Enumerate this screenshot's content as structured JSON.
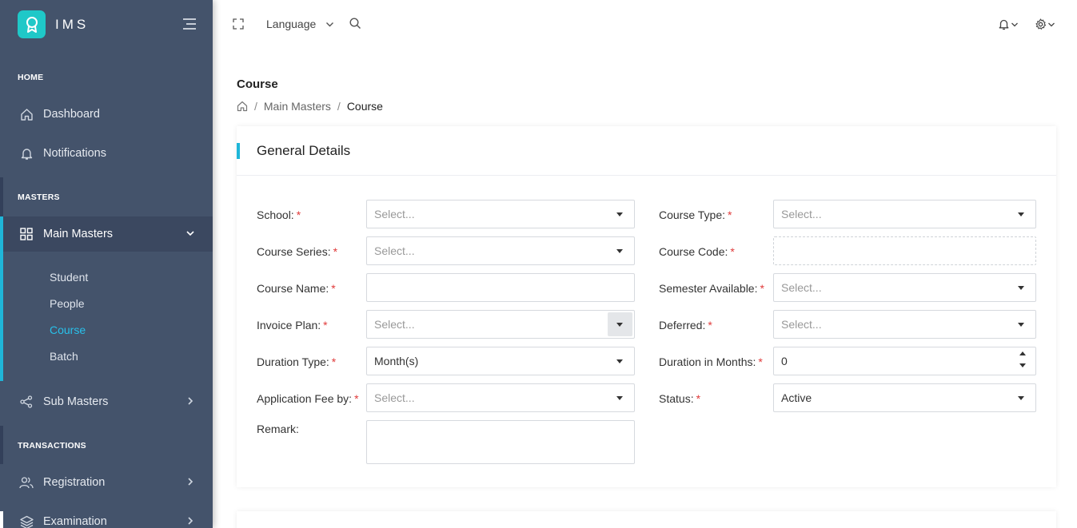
{
  "brand": {
    "name": "IMS"
  },
  "sidebar": {
    "sections": {
      "home": "HOME",
      "masters": "MASTERS",
      "transactions": "TRANSACTIONS"
    },
    "items": {
      "dashboard": "Dashboard",
      "notifications": "Notifications",
      "main_masters": "Main Masters",
      "sub_masters": "Sub Masters",
      "registration": "Registration",
      "examination": "Examination"
    },
    "submenu": [
      "Student",
      "People",
      "Course",
      "Batch"
    ]
  },
  "topbar": {
    "language": "Language"
  },
  "page": {
    "title": "Course",
    "breadcrumb": {
      "parent": "Main Masters",
      "current": "Course"
    }
  },
  "form": {
    "header": "General Details",
    "placeholder": "Select...",
    "labels": {
      "school": "School:",
      "course_type": "Course Type:",
      "course_series": "Course Series:",
      "course_code": "Course Code:",
      "course_name": "Course Name:",
      "semester_available": "Semester Available:",
      "invoice_plan": "Invoice Plan:",
      "deferred": "Deferred:",
      "duration_type": "Duration Type:",
      "duration_months": "Duration in Months:",
      "application_fee": "Application Fee by:",
      "status": "Status:",
      "remark": "Remark:"
    },
    "required_mark": "*",
    "values": {
      "duration_type": "Month(s)",
      "duration_months": "0",
      "status": "Active"
    }
  },
  "colors": {
    "sidebar": "#44536b",
    "accent": "#1fb6d9",
    "logo": "#1fc8c8",
    "required": "#e03a3a"
  }
}
